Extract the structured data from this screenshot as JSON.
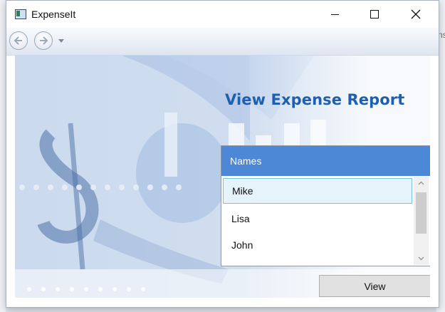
{
  "window": {
    "title": "ExpenseIt"
  },
  "nav": {
    "back": "back",
    "forward": "forward"
  },
  "page": {
    "heading": "View Expense Report"
  },
  "names_list": {
    "header": "Names",
    "items": [
      "Mike",
      "Lisa",
      "John"
    ],
    "selected": "Mike"
  },
  "buttons": {
    "view": "View"
  },
  "desktop": {
    "edge_text": "ns"
  },
  "colors": {
    "heading": "#1f5fb0",
    "list_header": "#4d88d6",
    "selection": "#e5f3fb"
  }
}
